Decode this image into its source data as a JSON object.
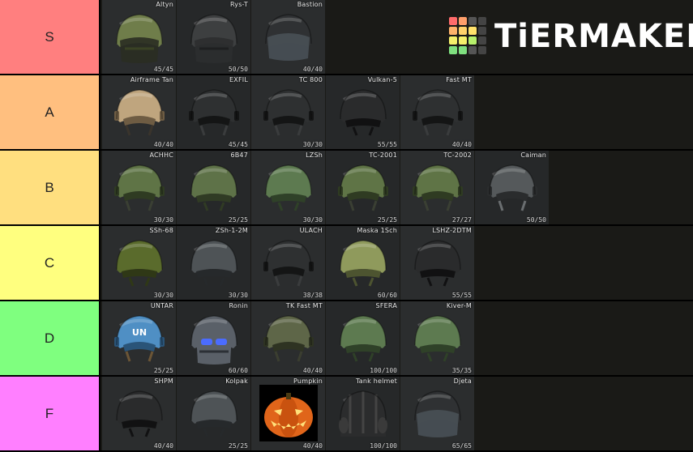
{
  "brand": {
    "name": "TiERMAKER"
  },
  "colors": {
    "S": "#ff7f7f",
    "A": "#ffbf7f",
    "B": "#ffdf7f",
    "C": "#ffff7f",
    "D": "#7fff7f",
    "F": "#ff7fff",
    "logo_cells": [
      "#ff6b6b",
      "#ff9f6b",
      "#555555",
      "#444444",
      "#ffb36b",
      "#ffd26b",
      "#ffe26b",
      "#444444",
      "#f5f06b",
      "#f5f06b",
      "#b6f06b",
      "#444444",
      "#7fe07f",
      "#7fe07f",
      "#555555",
      "#444444"
    ]
  },
  "tiers": [
    {
      "label": "S",
      "items": [
        {
          "name": "Altyn",
          "stat": "45/45",
          "helmet": "olive-faceshield"
        },
        {
          "name": "Rys-T",
          "stat": "50/50",
          "helmet": "black-faceshield"
        },
        {
          "name": "Bastion",
          "stat": "40/40",
          "helmet": "black-visor"
        }
      ]
    },
    {
      "label": "A",
      "items": [
        {
          "name": "Airframe Tan",
          "stat": "40/40",
          "helmet": "tan-ops"
        },
        {
          "name": "EXFIL",
          "stat": "45/45",
          "helmet": "black-ops"
        },
        {
          "name": "TC 800",
          "stat": "30/30",
          "helmet": "black-ops"
        },
        {
          "name": "Vulkan-5",
          "stat": "55/55",
          "helmet": "black-dome"
        },
        {
          "name": "Fast MT",
          "stat": "40/40",
          "helmet": "black-ops"
        }
      ]
    },
    {
      "label": "B",
      "items": [
        {
          "name": "ACHHC",
          "stat": "30/30",
          "helmet": "green-ops"
        },
        {
          "name": "6B47",
          "stat": "25/25",
          "helmet": "green-dome"
        },
        {
          "name": "LZSh",
          "stat": "30/30",
          "helmet": "camo-dome"
        },
        {
          "name": "TC-2001",
          "stat": "25/25",
          "helmet": "green-ops"
        },
        {
          "name": "TC-2002",
          "stat": "27/27",
          "helmet": "green-ops"
        },
        {
          "name": "Caiman",
          "stat": "50/50",
          "helmet": "grey-ops"
        }
      ]
    },
    {
      "label": "C",
      "items": [
        {
          "name": "SSh-68",
          "stat": "30/30",
          "helmet": "green-steel"
        },
        {
          "name": "ZSh-1-2M",
          "stat": "30/30",
          "helmet": "grey-dome"
        },
        {
          "name": "ULACH",
          "stat": "38/38",
          "helmet": "black-ops"
        },
        {
          "name": "Maska 1Sch",
          "stat": "60/60",
          "helmet": "olive-dome"
        },
        {
          "name": "LSHZ-2DTM",
          "stat": "55/55",
          "helmet": "black-dome"
        }
      ]
    },
    {
      "label": "D",
      "items": [
        {
          "name": "UNTAR",
          "stat": "25/25",
          "helmet": "blue-un"
        },
        {
          "name": "Ronin",
          "stat": "60/60",
          "helmet": "ronin"
        },
        {
          "name": "TK Fast MT",
          "stat": "40/40",
          "helmet": "olive-ops"
        },
        {
          "name": "SFERA",
          "stat": "100/100",
          "helmet": "camo-dome"
        },
        {
          "name": "Kiver-M",
          "stat": "35/35",
          "helmet": "camo-dome"
        }
      ]
    },
    {
      "label": "F",
      "items": [
        {
          "name": "SHPM",
          "stat": "40/40",
          "helmet": "black-dome"
        },
        {
          "name": "Kolpak",
          "stat": "25/25",
          "helmet": "grey-dome"
        },
        {
          "name": "Pumpkin",
          "stat": "40/40",
          "helmet": "pumpkin"
        },
        {
          "name": "Tank helmet",
          "stat": "100/100",
          "helmet": "tank"
        },
        {
          "name": "Djeta",
          "stat": "65/65",
          "helmet": "black-visor"
        }
      ]
    }
  ]
}
